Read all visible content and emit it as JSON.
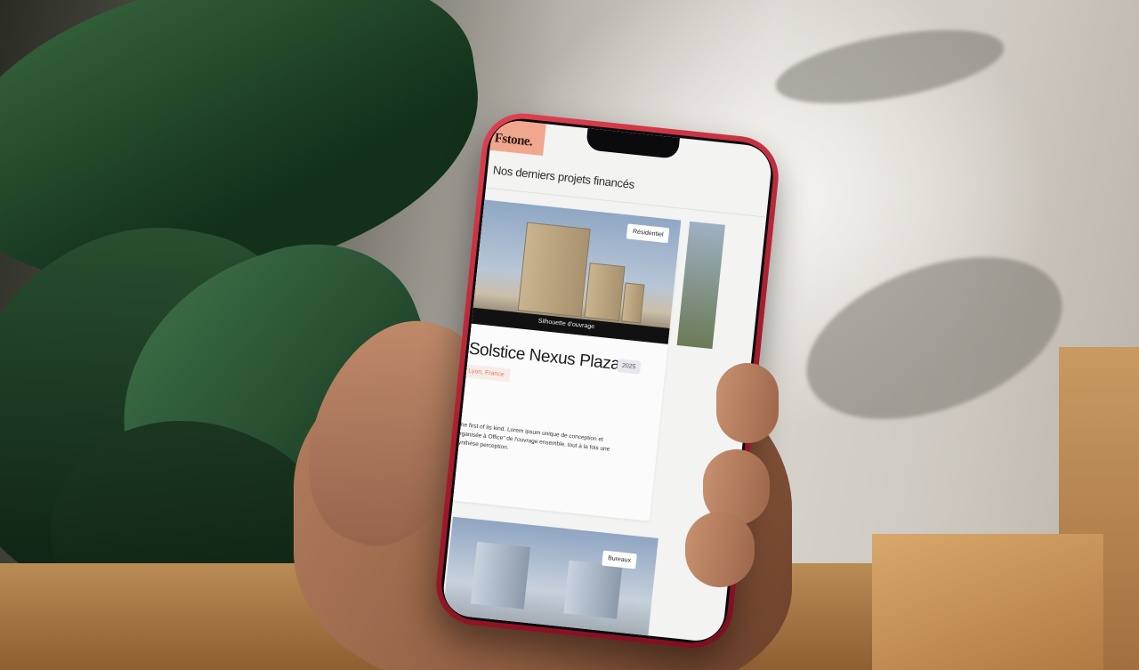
{
  "app": {
    "logo": "Fstone."
  },
  "page": {
    "heading": "Nos derniers projets financés"
  },
  "projects": [
    {
      "category": "Résidentiel",
      "image_caption": "Silhouette d'ouvrage",
      "title": "Solstice Nexus Plaza",
      "year": "2025",
      "location": "Lyon, France",
      "description": "The first of its kind. Lorem ipsum unique de conception et organisée à Office\" de l'ouvrage ensemble, tout à la fois une synthèse perception."
    },
    {
      "category": "Bureaux"
    }
  ]
}
